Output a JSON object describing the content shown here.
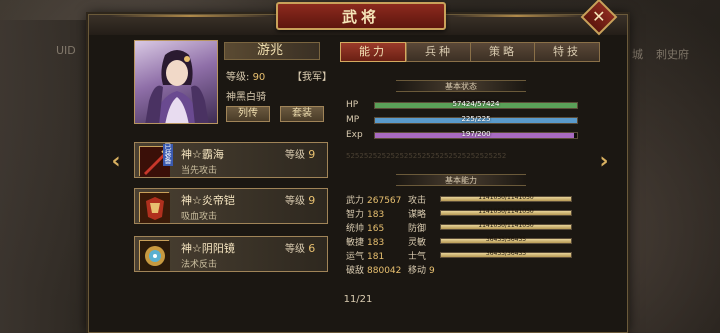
{
  "window": {
    "title": "武将",
    "close": "✕"
  },
  "background": {
    "left_label": "UID",
    "right_labels": [
      "城",
      "刺史府"
    ]
  },
  "general": {
    "name": "游兆",
    "level_label": "等级:",
    "level": "90",
    "faction": "【我军】",
    "unit_type": "神黑白骑",
    "buttons": {
      "bio": "列传",
      "equip": "套装"
    }
  },
  "equipment": [
    {
      "name": "神☆霸海",
      "level_label": "等级",
      "level": "9",
      "desc": "当先攻击",
      "tag": "已装备",
      "icon": "sword-icon"
    },
    {
      "name": "神☆炎帝铠",
      "level_label": "等级",
      "level": "9",
      "desc": "吸血攻击",
      "tag": "",
      "icon": "armor-icon"
    },
    {
      "name": "神☆阴阳镜",
      "level_label": "等级",
      "level": "6",
      "desc": "法术反击",
      "tag": "",
      "icon": "mirror-icon"
    }
  ],
  "tabs": [
    {
      "label": "能力",
      "active": true
    },
    {
      "label": "兵种",
      "active": false
    },
    {
      "label": "策略",
      "active": false
    },
    {
      "label": "特技",
      "active": false
    }
  ],
  "basic_status": {
    "heading": "基本状态",
    "bars": [
      {
        "label": "HP",
        "text": "57424/57424",
        "fraction": 1.0,
        "color": "#5aa058"
      },
      {
        "label": "MP",
        "text": "225/225",
        "fraction": 1.0,
        "color": "#5a9acb"
      },
      {
        "label": "Exp",
        "text": "197/200",
        "fraction": 0.985,
        "color": "#a86ac0"
      }
    ]
  },
  "deco_text": "525252525252525252525252525252525252",
  "basic_ability": {
    "heading": "基本能力",
    "left": [
      {
        "label": "武力",
        "value": "267567"
      },
      {
        "label": "智力",
        "value": "183"
      },
      {
        "label": "统帅",
        "value": "165"
      },
      {
        "label": "敏捷",
        "value": "183"
      },
      {
        "label": "运气",
        "value": "181"
      },
      {
        "label": "破敌",
        "value": "880042"
      }
    ],
    "right": [
      {
        "label": "攻击",
        "text": "1141050/1141050",
        "fraction": 1.0
      },
      {
        "label": "谋略",
        "text": "1141050/1141050",
        "fraction": 1.0
      },
      {
        "label": "防御",
        "text": "1141050/1141050",
        "fraction": 1.0
      },
      {
        "label": "灵敏",
        "text": "36435/36435",
        "fraction": 1.0
      },
      {
        "label": "士气",
        "text": "36433/36433",
        "fraction": 1.0
      }
    ],
    "move_label": "移动",
    "move_value": "9"
  },
  "pager": {
    "text": "11/21"
  },
  "nav": {
    "prev": "‹",
    "next": "›"
  }
}
